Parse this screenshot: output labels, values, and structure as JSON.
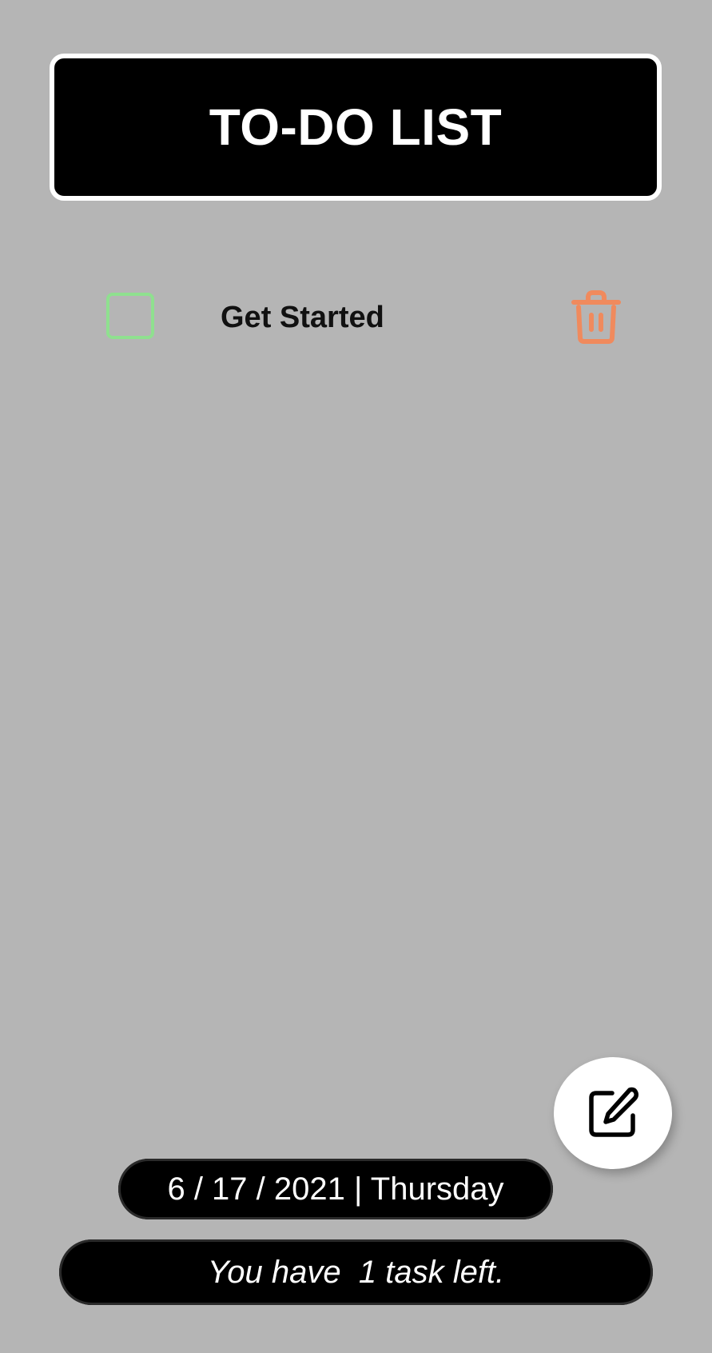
{
  "header": {
    "title": "TO-DO LIST"
  },
  "tasks": [
    {
      "label": "Get Started",
      "checked": false
    }
  ],
  "footer": {
    "date": "6 / 17 / 2021 | Thursday",
    "status": "You have  1 task left."
  },
  "icons": {
    "checkbox": "checkbox-icon",
    "delete": "trash-icon",
    "add": "edit-icon"
  },
  "colors": {
    "background": "#b5b5b5",
    "header_bg": "#000000",
    "checkbox": "#8fe08f",
    "trash": "#f08a5d",
    "fab_bg": "#ffffff"
  }
}
